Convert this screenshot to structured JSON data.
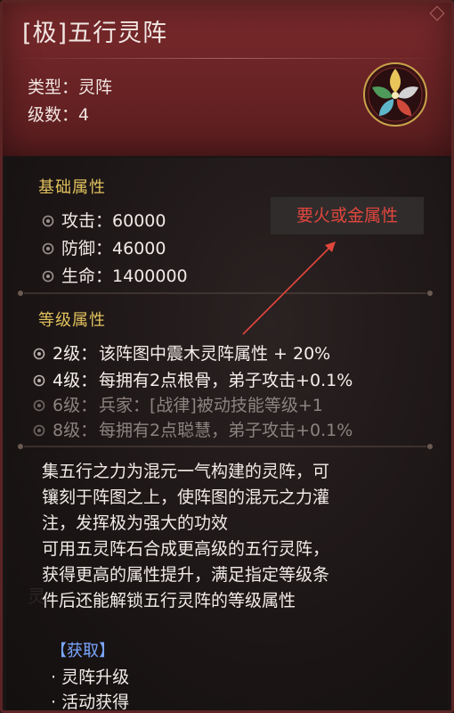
{
  "card": {
    "title": "[极]五行灵阵",
    "type_label": "类型：",
    "type_value": "灵阵",
    "level_label": "级数：",
    "level_value": "4",
    "emblem_icon": "five-elements-emblem-icon",
    "accent": "#e1c15d",
    "header_color": "#6c2426"
  },
  "base": {
    "title": "基础属性",
    "stats": [
      {
        "label": "攻击：",
        "value": "60000"
      },
      {
        "label": "防御：",
        "value": "46000"
      },
      {
        "label": "生命：",
        "value": "1400000"
      }
    ]
  },
  "levels": {
    "title": "等级属性",
    "items": [
      {
        "level": "2级：",
        "text": "该阵图中震木灵阵属性 + 20%",
        "active": true
      },
      {
        "level": "4级：",
        "text": "每拥有2点根骨，弟子攻击+0.1%",
        "active": true
      },
      {
        "level": "6级：",
        "text": "兵家：[战律]被动技能等级+1",
        "active": false
      },
      {
        "level": "8级：",
        "text": "每拥有2点聪慧，弟子攻击+0.1%",
        "active": false
      }
    ]
  },
  "description": [
    "集五行之力为混元一气构建的灵阵，可",
    "镶刻于阵图之上，使阵图的混元之力灌",
    "注，发挥极为强大的功效",
    "可用五灵阵石合成更高级的五行灵阵，",
    "获得更高的属性提升，满足指定等级条",
    "件后还能解锁五行灵阵的等级属性"
  ],
  "acquire": {
    "title": "【获取】",
    "items": [
      "· 灵阵升级",
      "· 活动获得"
    ]
  },
  "annotation": {
    "text": "要火或金属性",
    "color": "#e0463d"
  }
}
